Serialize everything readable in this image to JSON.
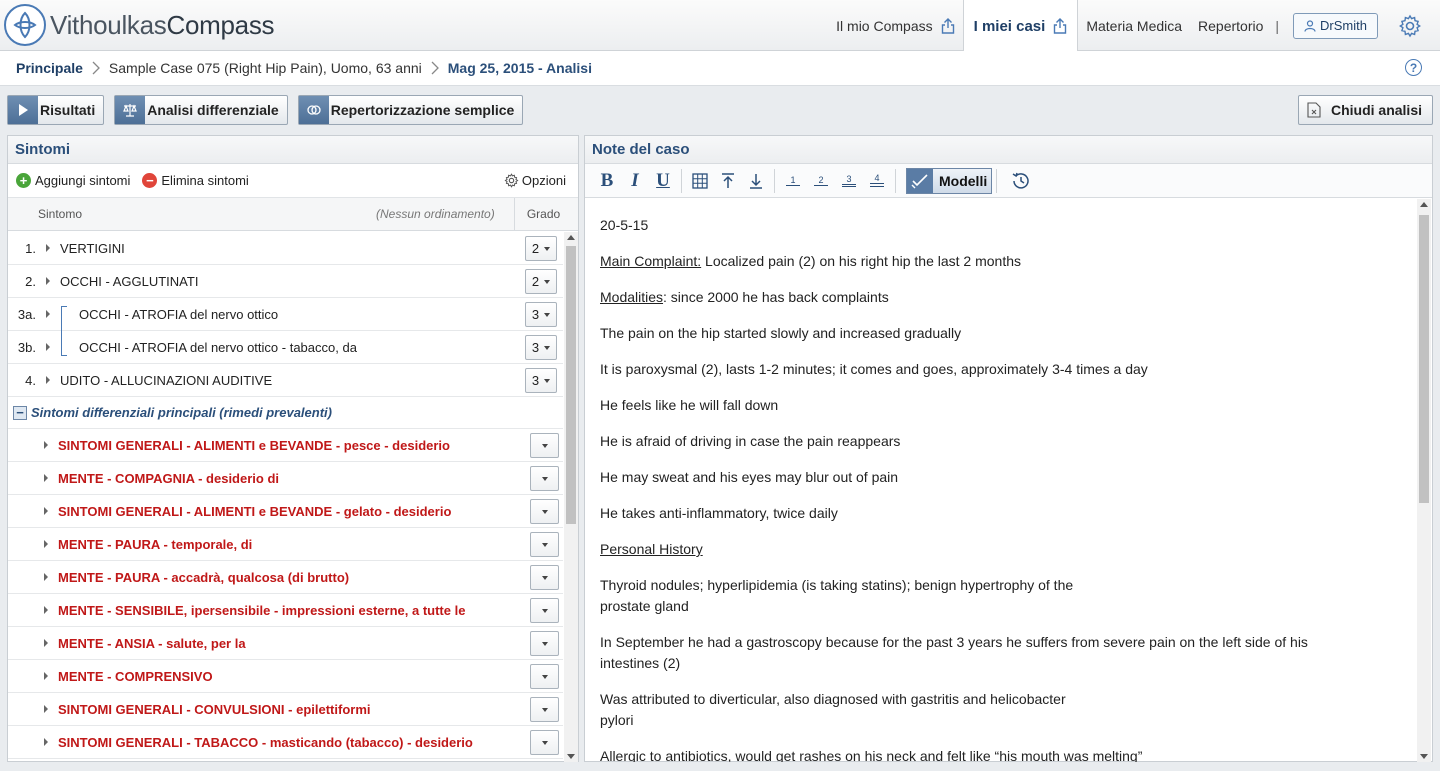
{
  "header": {
    "logo_light": "Vithoulkas",
    "logo_bold": "Compass",
    "nav": [
      {
        "label": "Il mio Compass",
        "share": true,
        "active": false
      },
      {
        "label": "I miei casi",
        "share": true,
        "active": true
      },
      {
        "label": "Materia Medica",
        "share": false,
        "active": false
      },
      {
        "label": "Repertorio",
        "share": false,
        "active": false
      }
    ],
    "separator": "|",
    "user": "DrSmith"
  },
  "breadcrumb": {
    "home": "Principale",
    "case": "Sample Case 075 (Right Hip Pain), Uomo, 63 anni",
    "current": "Mag 25, 2015 - Analisi",
    "help": "?"
  },
  "toolbar": {
    "results": "Risultati",
    "differential": "Analisi differenziale",
    "repertorization": "Repertorizzazione semplice",
    "close": "Chiudi analisi"
  },
  "symptoms": {
    "title": "Sintomi",
    "add": "Aggiungi sintomi",
    "remove": "Elimina sintomi",
    "options": "Opzioni",
    "col_symptom": "Sintomo",
    "col_sort": "(Nessun ordinamento)",
    "col_grade": "Grado",
    "rows": [
      {
        "num": "1.",
        "text": "VERTIGINI",
        "grade": "2",
        "bracket": false
      },
      {
        "num": "2.",
        "text": "OCCHI - AGGLUTINATI",
        "grade": "2",
        "bracket": false
      },
      {
        "num": "3a.",
        "text": "OCCHI - ATROFIA del nervo ottico",
        "grade": "3",
        "bracket": true
      },
      {
        "num": "3b.",
        "text": "OCCHI - ATROFIA del nervo ottico - tabacco, da",
        "grade": "3",
        "bracket": true
      },
      {
        "num": "4.",
        "text": "UDITO - ALLUCINAZIONI AUDITIVE",
        "grade": "3",
        "bracket": false
      }
    ],
    "section_minus": "−",
    "section": "Sintomi differenziali principali (rimedi prevalenti)",
    "diff_rows": [
      "SINTOMI GENERALI - ALIMENTI e BEVANDE - pesce - desiderio",
      "MENTE - COMPAGNIA - desiderio di",
      "SINTOMI GENERALI - ALIMENTI e BEVANDE - gelato - desiderio",
      "MENTE - PAURA - temporale, di",
      "MENTE - PAURA - accadrà, qualcosa (di brutto)",
      "MENTE - SENSIBILE, ipersensibile - impressioni esterne, a tutte le",
      "MENTE - ANSIA - salute, per la",
      "MENTE - COMPRENSIVO",
      "SINTOMI GENERALI - CONVULSIONI - epilettiformi",
      "SINTOMI GENERALI - TABACCO - masticando (tabacco) - desiderio"
    ]
  },
  "notes": {
    "title": "Note del caso",
    "toolbar": {
      "bold": "B",
      "italic": "I",
      "underline": "U",
      "models": "Modelli",
      "h1": "1",
      "h2": "2",
      "h3": "3",
      "h4": "4"
    },
    "paragraphs": [
      {
        "label": "",
        "text": "20-5-15"
      },
      {
        "label": "Main Complaint:",
        "text": " Localized pain (2) on his right hip the last 2 months"
      },
      {
        "label": "Modalities",
        "text": ": since 2000 he has back complaints"
      },
      {
        "label": "",
        "text": "The pain on the hip started slowly and increased gradually"
      },
      {
        "label": "",
        "text": "It is paroxysmal (2), lasts 1-2 minutes; it comes and goes, approximately 3-4 times a day"
      },
      {
        "label": "",
        "text": "He feels like he will fall down"
      },
      {
        "label": "",
        "text": "He is afraid of driving in case the pain reappears"
      },
      {
        "label": "",
        "text": "He may sweat and his eyes may blur out of pain"
      },
      {
        "label": "",
        "text": "He takes anti-inflammatory, twice daily"
      },
      {
        "label": "Personal History",
        "text": ""
      },
      {
        "label": "",
        "text": "Thyroid nodules; hyperlipidemia (is taking statins); benign hypertrophy of the\nprostate gland"
      },
      {
        "label": "",
        "text": "In September he had a gastroscopy because for the past 3 years he suffers from severe pain on the left side of his\nintestines (2)"
      },
      {
        "label": "",
        "text": "Was attributed to diverticular, also diagnosed with gastritis and helicobacter\npylori"
      },
      {
        "label": "",
        "text": "Allergic to antibiotics, would get rashes on his neck and felt like “his mouth was melting”"
      }
    ]
  },
  "colors": {
    "accent": "#2b4f7a",
    "diff_text": "#c01818",
    "button_icon": "#5a7ca5"
  }
}
